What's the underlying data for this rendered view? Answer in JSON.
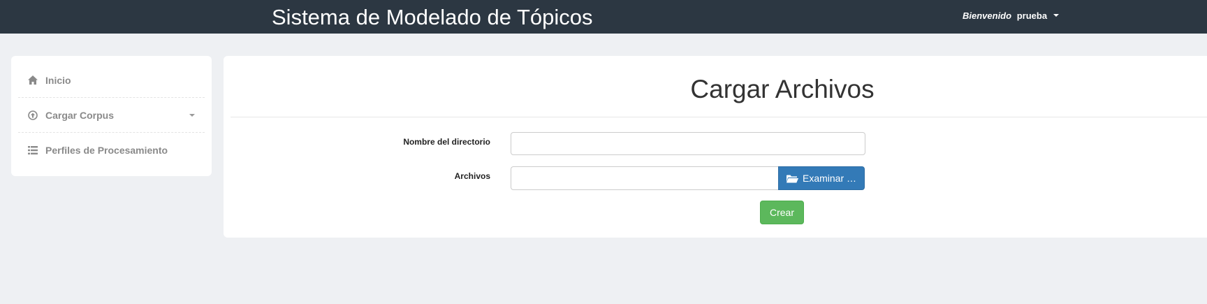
{
  "app": {
    "title": "Sistema de Modelado de Tópicos"
  },
  "user_menu": {
    "welcome": "Bienvenido",
    "username": "prueba"
  },
  "sidebar": {
    "items": [
      {
        "label": "Inicio",
        "icon": "home-icon"
      },
      {
        "label": "Cargar Corpus",
        "icon": "upload-circle-icon",
        "has_dropdown": true
      },
      {
        "label": "Perfiles de Procesamiento",
        "icon": "list-icon"
      }
    ]
  },
  "main": {
    "title": "Cargar Archivos",
    "form": {
      "directory_label": "Nombre del directorio",
      "directory_value": "",
      "files_label": "Archivos",
      "files_value": "",
      "browse_label": "Examinar …",
      "submit_label": "Crear"
    }
  },
  "colors": {
    "navbar": "#2c3742",
    "background": "#eef0f3",
    "primary": "#337ab7",
    "success": "#5cb85c"
  }
}
